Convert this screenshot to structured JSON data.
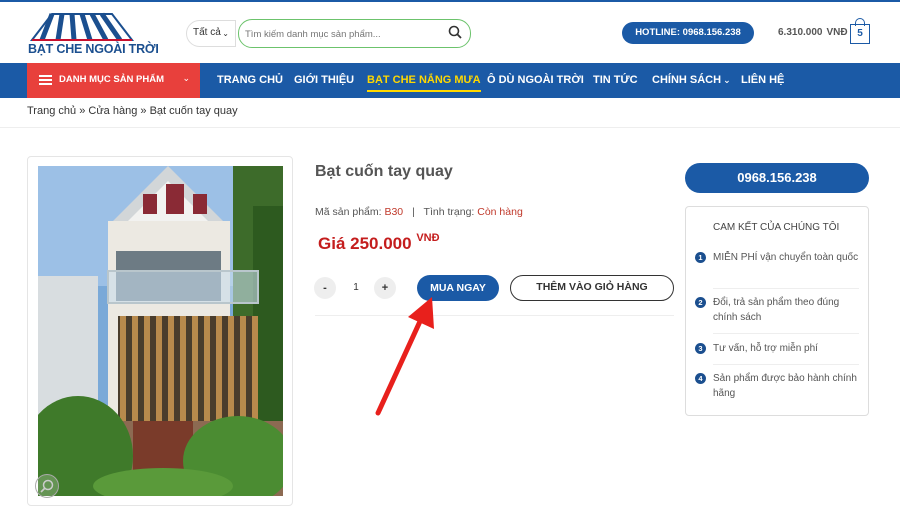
{
  "brand": {
    "name": "BẠT CHE NGOÀI TRỜI",
    "color": "#1b5aa6",
    "accent": "#e8403c"
  },
  "search": {
    "category": "Tất cả",
    "placeholder": "Tìm kiếm danh mục sản phẩm...",
    "value": ""
  },
  "header": {
    "hotline": "HOTLINE: 0968.156.238",
    "cart_total": "6.310.000",
    "cart_currency": "VNĐ",
    "cart_count": "5"
  },
  "nav": {
    "category_label": "DANH MỤC SẢN PHẨM",
    "items": [
      "TRANG CHỦ",
      "GIỚI THIỆU",
      "BẠT CHE NẮNG MƯA",
      "Ô DÙ NGOÀI TRỜI",
      "TIN TỨC",
      "CHÍNH SÁCH",
      "LIÊN HỆ"
    ],
    "active": "BẠT CHE NẮNG MƯA"
  },
  "breadcrumb": {
    "home": "Trang chủ",
    "sep": "»",
    "shop": "Cửa hàng",
    "current": "Bạt cuốn tay quay"
  },
  "product": {
    "title": "Bạt cuốn tay quay",
    "sku_label": "Mã sản phẩm:",
    "sku": "B30",
    "status_label": "Tình trạng:",
    "status": "Còn hàng",
    "price": "Giá 250.000",
    "currency": "VNĐ",
    "qty_minus": "-",
    "qty": "1",
    "qty_plus": "+",
    "buy_now": "MUA NGAY",
    "add_to_cart": "THÊM VÀO GIỎ HÀNG"
  },
  "sidebar": {
    "phone": "0968.156.238",
    "commit_title": "CAM KẾT CỦA CHÚNG TÔI",
    "commitments": [
      {
        "n": "1",
        "text": "MIỄN PHÍ vận chuyển toàn quốc"
      },
      {
        "n": "2",
        "text": "Đổi, trả sản phẩm theo đúng chính sách"
      },
      {
        "n": "3",
        "text": "Tư vấn, hỗ trợ miễn phí"
      },
      {
        "n": "4",
        "text": "Sản phẩm được bảo hành chính hãng"
      }
    ]
  }
}
